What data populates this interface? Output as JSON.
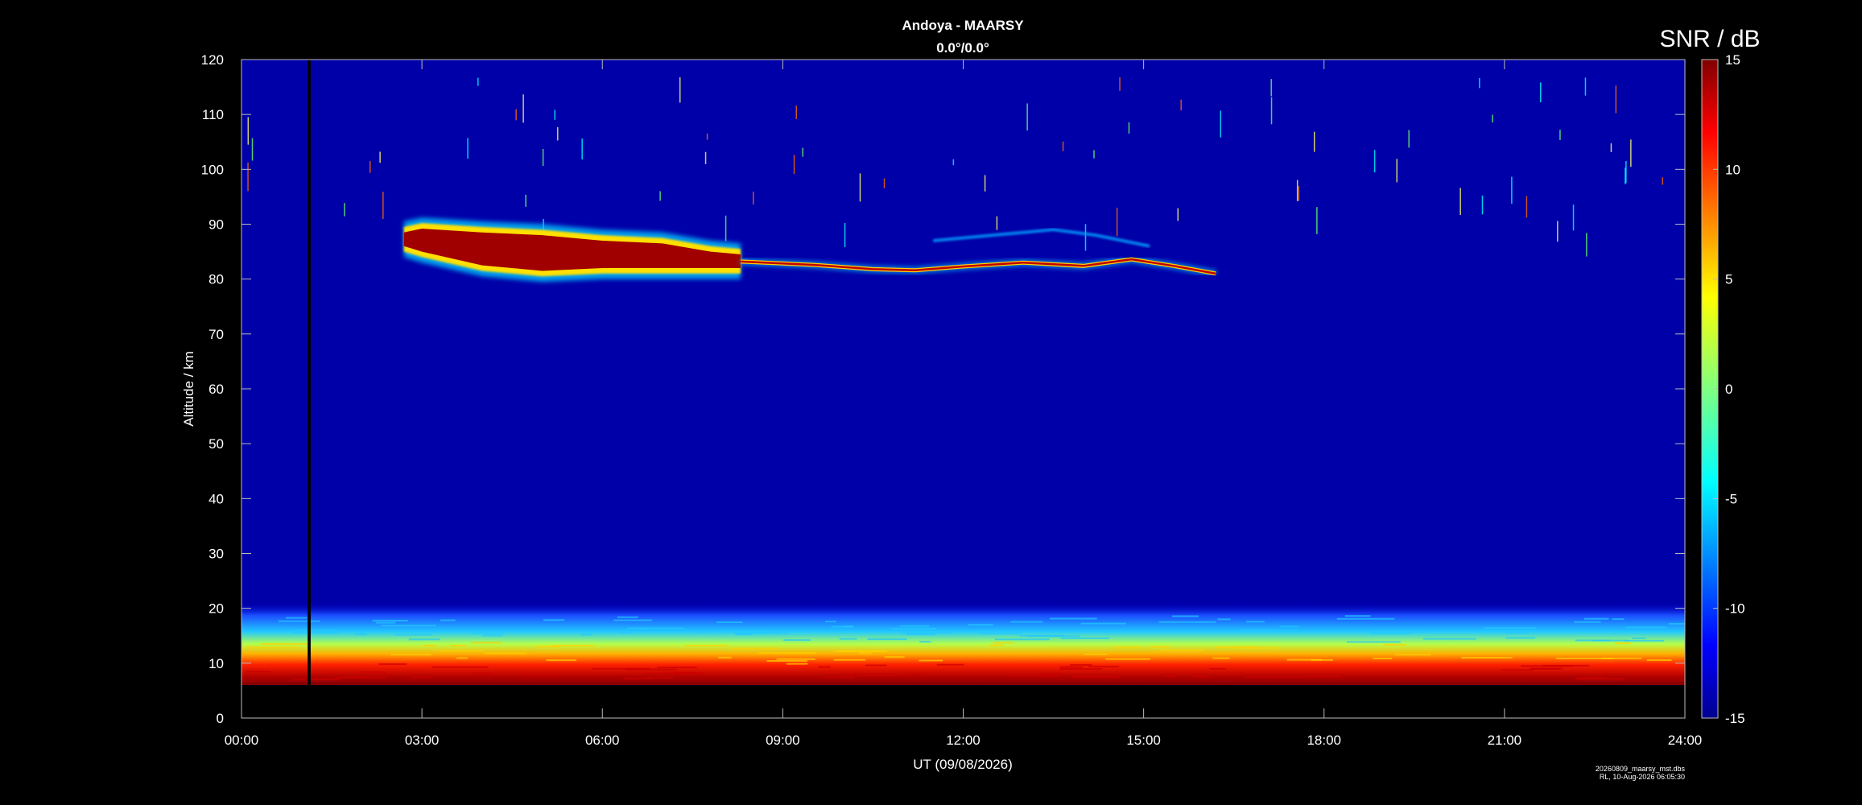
{
  "chart_data": {
    "type": "heatmap",
    "title": "Andoya - MAARSY",
    "subtitle": "0.0°/0.0°",
    "xlabel": "UT (09/08/2026)",
    "ylabel": "Altitude / km",
    "x_ticks": [
      "00:00",
      "03:00",
      "06:00",
      "09:00",
      "12:00",
      "15:00",
      "18:00",
      "21:00",
      "24:00"
    ],
    "y_ticks": [
      0,
      10,
      20,
      30,
      40,
      50,
      60,
      70,
      80,
      90,
      100,
      110,
      120
    ],
    "xlim_hours": [
      0,
      24
    ],
    "ylim": [
      0,
      120
    ],
    "colorbar": {
      "label": "SNR / dB",
      "range": [
        -15,
        15
      ],
      "ticks": [
        15,
        10,
        5,
        0,
        -5,
        -10,
        -15
      ],
      "colormap": "jet"
    },
    "background_color": "#0000a8",
    "features": [
      {
        "name": "mesospheric layer core",
        "hours": [
          2.7,
          8.3
        ],
        "altitude_km": [
          81.5,
          88.5
        ],
        "snr_db": 15
      },
      {
        "name": "mesospheric echo thin trail",
        "hours": [
          8.3,
          16.2
        ],
        "altitude_km": [
          80.5,
          84.5
        ],
        "snr_db": 10
      },
      {
        "name": "upper faint trail",
        "hours": [
          11.5,
          15.1
        ],
        "altitude_km": [
          85,
          89
        ],
        "snr_db": -5
      },
      {
        "name": "tropospheric echoes",
        "hours": [
          0,
          24
        ],
        "altitude_km": [
          6,
          21
        ],
        "snr_db": 12
      },
      {
        "name": "data gap",
        "hours": [
          1.1,
          1.15
        ],
        "altitude_km": [
          6,
          120
        ]
      }
    ],
    "footnote": [
      "20260809_maarsy_mst.dbs",
      "RL, 10-Aug-2026 06:05:30"
    ]
  }
}
